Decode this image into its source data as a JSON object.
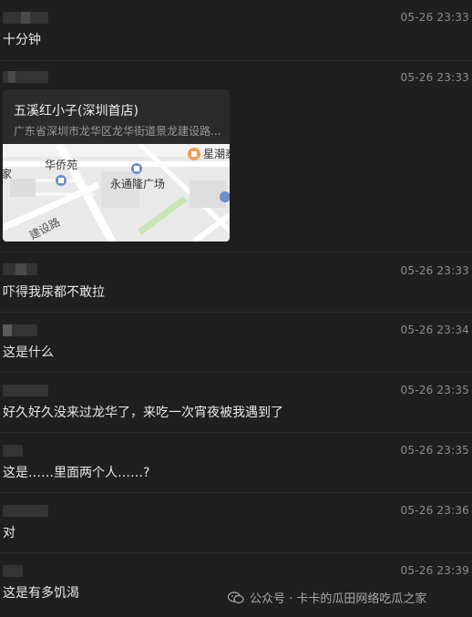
{
  "messages": [
    {
      "time": "05-26 23:33",
      "text": "十分钟"
    },
    {
      "time": "05-26 23:33",
      "location": {
        "title": "五溪红小子(深圳首店)",
        "address": "广东省深圳市龙华区龙华街道景龙建设路...",
        "map_labels": [
          "华侨苑",
          "永通隆广场",
          "星潮泰",
          "家",
          "建设路"
        ]
      }
    },
    {
      "time": "05-26 23:33",
      "text": "吓得我尿都不敢拉"
    },
    {
      "time": "05-26 23:34",
      "text": "这是什么"
    },
    {
      "time": "05-26 23:35",
      "text": "好久好久没来过龙华了，来吃一次宵夜被我遇到了"
    },
    {
      "time": "05-26 23:35",
      "text": "这是……里面两个人……?"
    },
    {
      "time": "05-26 23:36",
      "text": "对"
    },
    {
      "time": "05-26 23:39",
      "text": "这是有多饥渴"
    }
  ],
  "watermark": "公众号 · 卡卡的瓜田网络吃瓜之家",
  "colors": {
    "background": "#1f1f1f",
    "card": "#2b2b2b",
    "map_bg": "#e9e9e9",
    "road": "#ffffff",
    "park": "#c8e6b4",
    "poi_orange": "#f0a050",
    "poi_blue": "#6b8fc7"
  }
}
